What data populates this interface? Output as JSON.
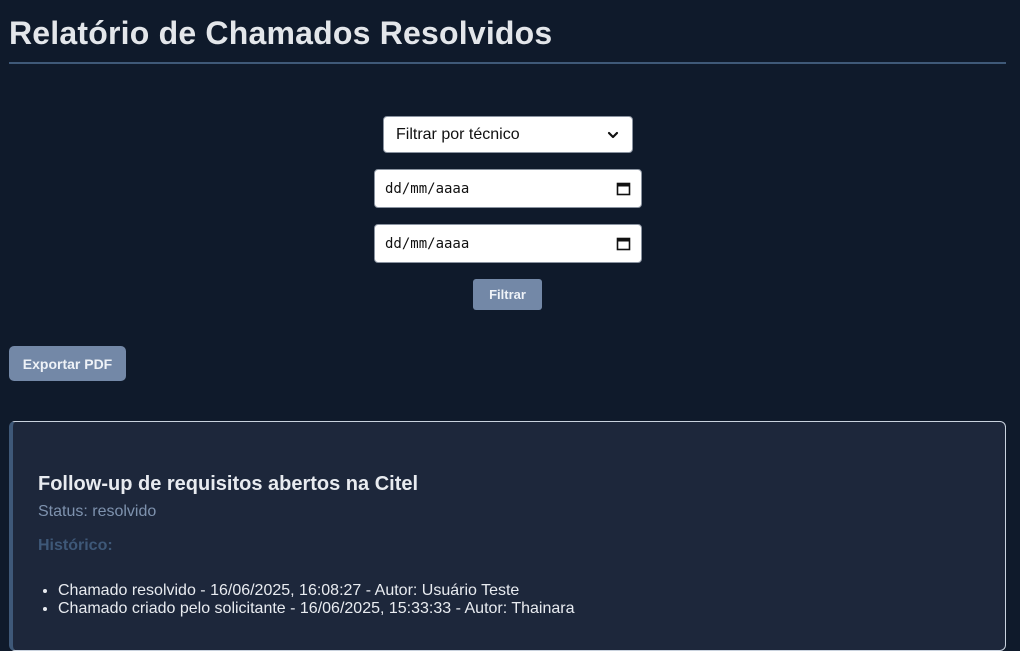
{
  "header": {
    "title": "Relatório de Chamados Resolvidos"
  },
  "filters": {
    "technician_select": {
      "selected": "Filtrar por técnico",
      "icon": "chevron-down-icon"
    },
    "date_start": {
      "value": "dd/mm/aaaa",
      "icon": "calendar-icon"
    },
    "date_end": {
      "value": "dd/mm/aaaa",
      "icon": "calendar-icon"
    },
    "filter_label": "Filtrar"
  },
  "actions": {
    "export_label": "Exportar PDF"
  },
  "tickets": [
    {
      "title": "Follow-up de requisitos abertos na Citel",
      "status": "Status: resolvido",
      "history_label": "Histórico:",
      "history": [
        "Chamado resolvido - 16/06/2025, 16:08:27 - Autor: Usuário Teste",
        "Chamado criado pelo solicitante - 16/06/2025, 15:33:33 - Autor: Thainara"
      ]
    }
  ],
  "colors": {
    "background": "#0f1a2b",
    "card": "#1d273b",
    "accent": "#3e5878",
    "button": "#7388a7"
  }
}
